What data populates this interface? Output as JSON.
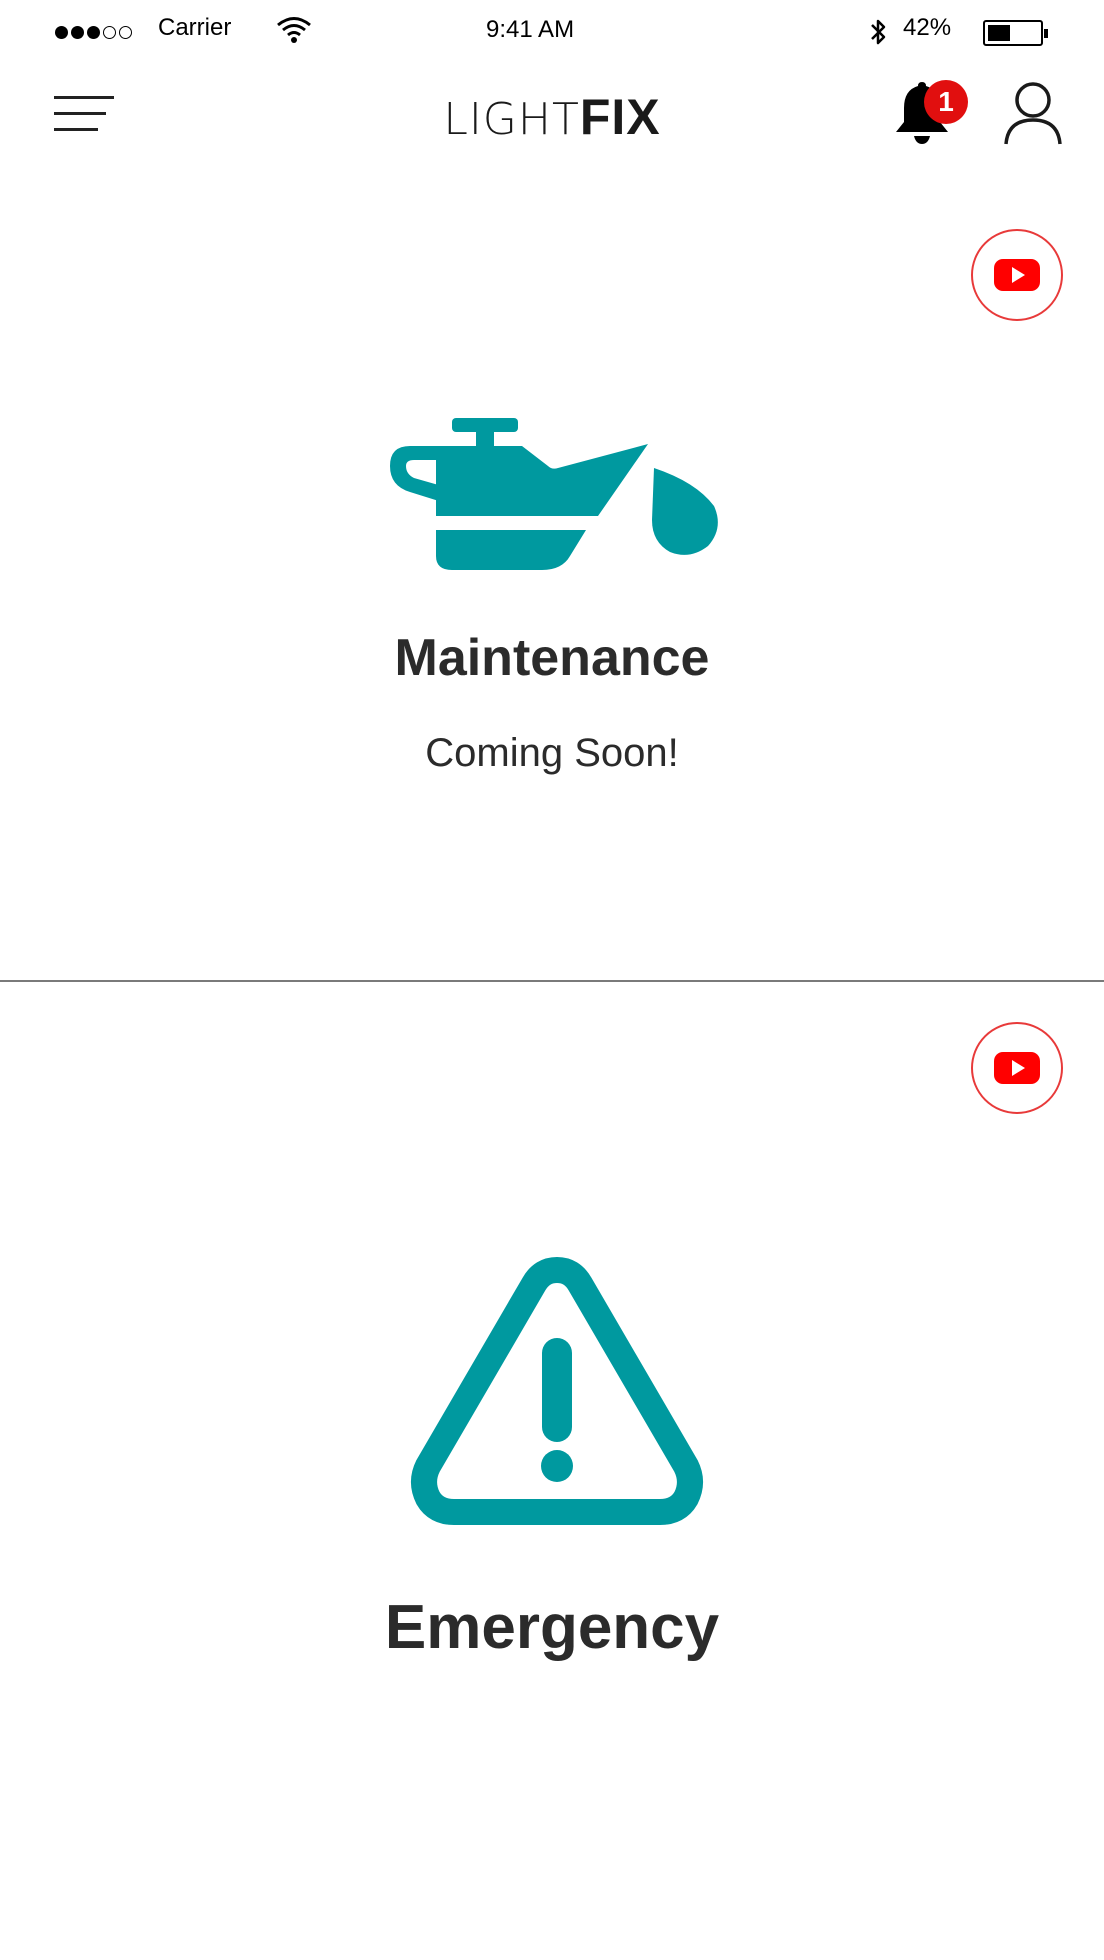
{
  "status_bar": {
    "carrier": "Carrier",
    "time": "9:41 AM",
    "battery_percent": "42%",
    "battery_level": 0.42,
    "signal_bars": 3,
    "signal_total": 5
  },
  "header": {
    "logo_light": "LIGHT",
    "logo_bold": "FIX",
    "notification_count": "1"
  },
  "cards": {
    "maintenance": {
      "title": "Maintenance",
      "subtitle": "Coming Soon!",
      "icon": "oil-can-icon"
    },
    "emergency": {
      "title": "Emergency",
      "icon": "warning-triangle-icon"
    }
  },
  "colors": {
    "accent": "#00999F",
    "badge": "#E10F0F",
    "youtube": "#FF0000"
  }
}
